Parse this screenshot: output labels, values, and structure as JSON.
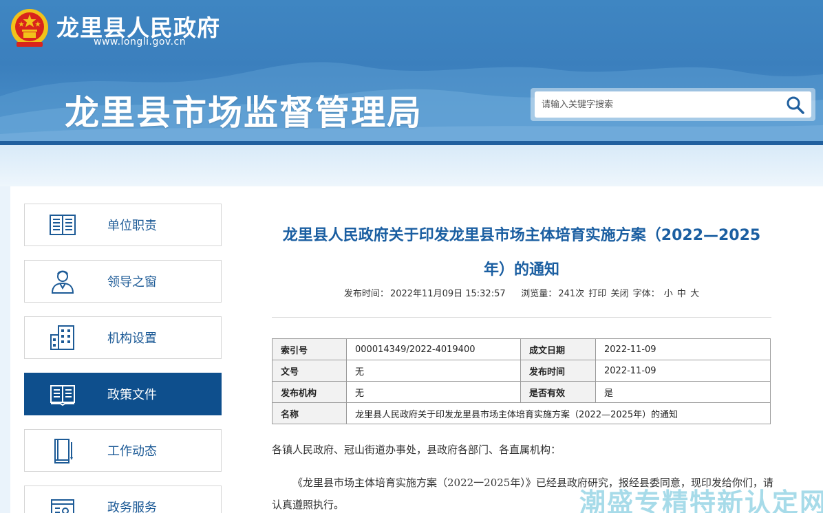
{
  "header": {
    "gov_name": "龙里县人民政府",
    "gov_url": "www.longli.gov.cn",
    "bureau_title": "龙里县市场监督管理局",
    "search_placeholder": "请输入关键字搜索"
  },
  "sidebar": {
    "items": [
      {
        "label": "单位职责",
        "icon": "book-list-icon"
      },
      {
        "label": "领导之窗",
        "icon": "person-icon"
      },
      {
        "label": "机构设置",
        "icon": "building-icon"
      },
      {
        "label": "政策文件",
        "icon": "open-book-icon",
        "active": true
      },
      {
        "label": "工作动态",
        "icon": "notebook-pen-icon"
      },
      {
        "label": "政务服务",
        "icon": "service-icon"
      }
    ]
  },
  "article": {
    "title": "龙里县人民政府关于印发龙里县市场主体培育实施方案（2022—2025年）的通知",
    "meta": {
      "publish_label": "发布时间：",
      "publish_time": "2022年11月09日 15:32:57",
      "views_label": "浏览量：",
      "views": "241次",
      "print": "打印",
      "close": "关闭",
      "font_label": "字体：",
      "font_small": "小",
      "font_medium": "中",
      "font_large": "大"
    },
    "info_table": {
      "rows": [
        {
          "k1": "索引号",
          "v1": "000014349/2022-4019400",
          "k2": "成文日期",
          "v2": "2022-11-09"
        },
        {
          "k1": "文号",
          "v1": "无",
          "k2": "发布时间",
          "v2": "2022-11-09"
        },
        {
          "k1": "发布机构",
          "v1": "无",
          "k2": "是否有效",
          "v2": "是"
        }
      ],
      "name_label": "名称",
      "name_value": "龙里县人民政府关于印发龙里县市场主体培育实施方案（2022—2025年）的通知"
    },
    "paragraphs": [
      "各镇人民政府、冠山街道办事处，县政府各部门、各直属机构：",
      "《龙里县市场主体培育实施方案（2022一2025年）》已经县政府研究，报经县委同意，现印发给你们，请认真遵照执行。"
    ]
  },
  "watermark": "潮盛专精特新认定网",
  "colors": {
    "header_blue": "#3f86c2",
    "active_nav": "#0e4f8d",
    "title_blue": "#1a5ea1"
  }
}
